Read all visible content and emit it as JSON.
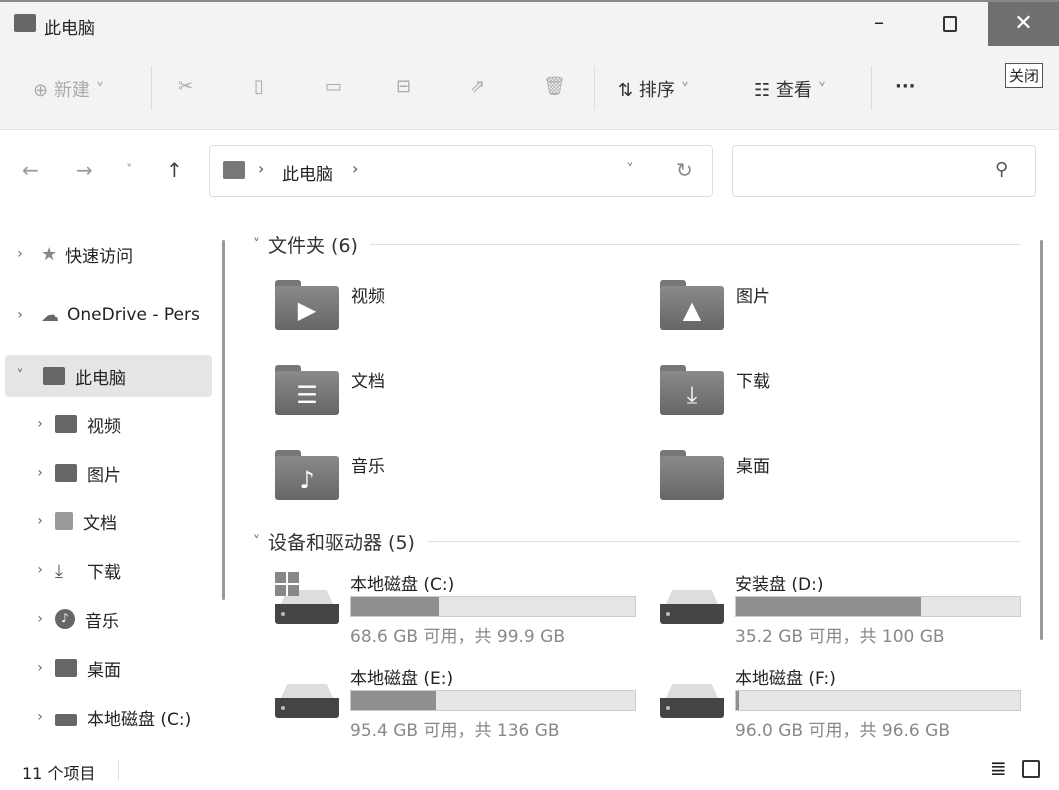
{
  "window": {
    "title": "此电脑",
    "tooltip": "关闭"
  },
  "toolbar": {
    "new": "新建",
    "sort": "排序",
    "view": "查看",
    "more": "···"
  },
  "address": {
    "location": "此电脑"
  },
  "sidebar": {
    "items": [
      {
        "label": "快速访问",
        "icon": "star-icon"
      },
      {
        "label": "OneDrive - Pers",
        "icon": "cloud-icon"
      },
      {
        "label": "此电脑",
        "icon": "computer-icon"
      },
      {
        "label": "视频",
        "icon": "video-icon"
      },
      {
        "label": "图片",
        "icon": "picture-icon"
      },
      {
        "label": "文档",
        "icon": "document-icon"
      },
      {
        "label": "下载",
        "icon": "download-icon"
      },
      {
        "label": "音乐",
        "icon": "music-icon"
      },
      {
        "label": "桌面",
        "icon": "desktop-icon"
      },
      {
        "label": "本地磁盘 (C:)",
        "icon": "drive-icon"
      }
    ]
  },
  "folders": {
    "header": "文件夹 (6)",
    "items": [
      "视频",
      "图片",
      "文档",
      "下载",
      "音乐",
      "桌面"
    ]
  },
  "drives": {
    "header": "设备和驱动器 (5)",
    "items": [
      {
        "name": "本地磁盘 (C:)",
        "info": "68.6 GB 可用，共 99.9 GB",
        "used": 0.31
      },
      {
        "name": "安装盘 (D:)",
        "info": "35.2 GB 可用，共 100 GB",
        "used": 0.65
      },
      {
        "name": "本地磁盘 (E:)",
        "info": "95.4 GB 可用，共 136 GB",
        "used": 0.3
      },
      {
        "name": "本地磁盘 (F:)",
        "info": "96.0 GB 可用，共 96.6 GB",
        "used": 0.01
      }
    ]
  },
  "status": {
    "count": "11 个项目"
  }
}
